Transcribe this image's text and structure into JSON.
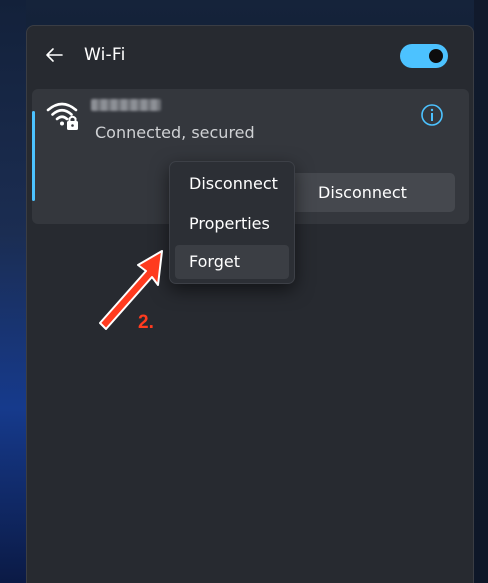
{
  "header": {
    "title": "Wi-Fi",
    "back_icon": "arrow-left-icon",
    "toggle_on": true
  },
  "network": {
    "ssid": "xxxxxxxxxxx",
    "status": "Connected, secured",
    "wifi_icon": "wifi-secured-icon",
    "info_icon": "info-icon",
    "disconnect_label": "Disconnect"
  },
  "context_menu": {
    "items": [
      {
        "label": "Disconnect"
      },
      {
        "label": "Properties"
      },
      {
        "label": "Forget"
      }
    ]
  },
  "annotation": {
    "step": "2."
  },
  "colors": {
    "accent": "#4cc2ff",
    "panel": "#272a30",
    "card": "#34373d",
    "annotation": "#ff3b1f"
  }
}
